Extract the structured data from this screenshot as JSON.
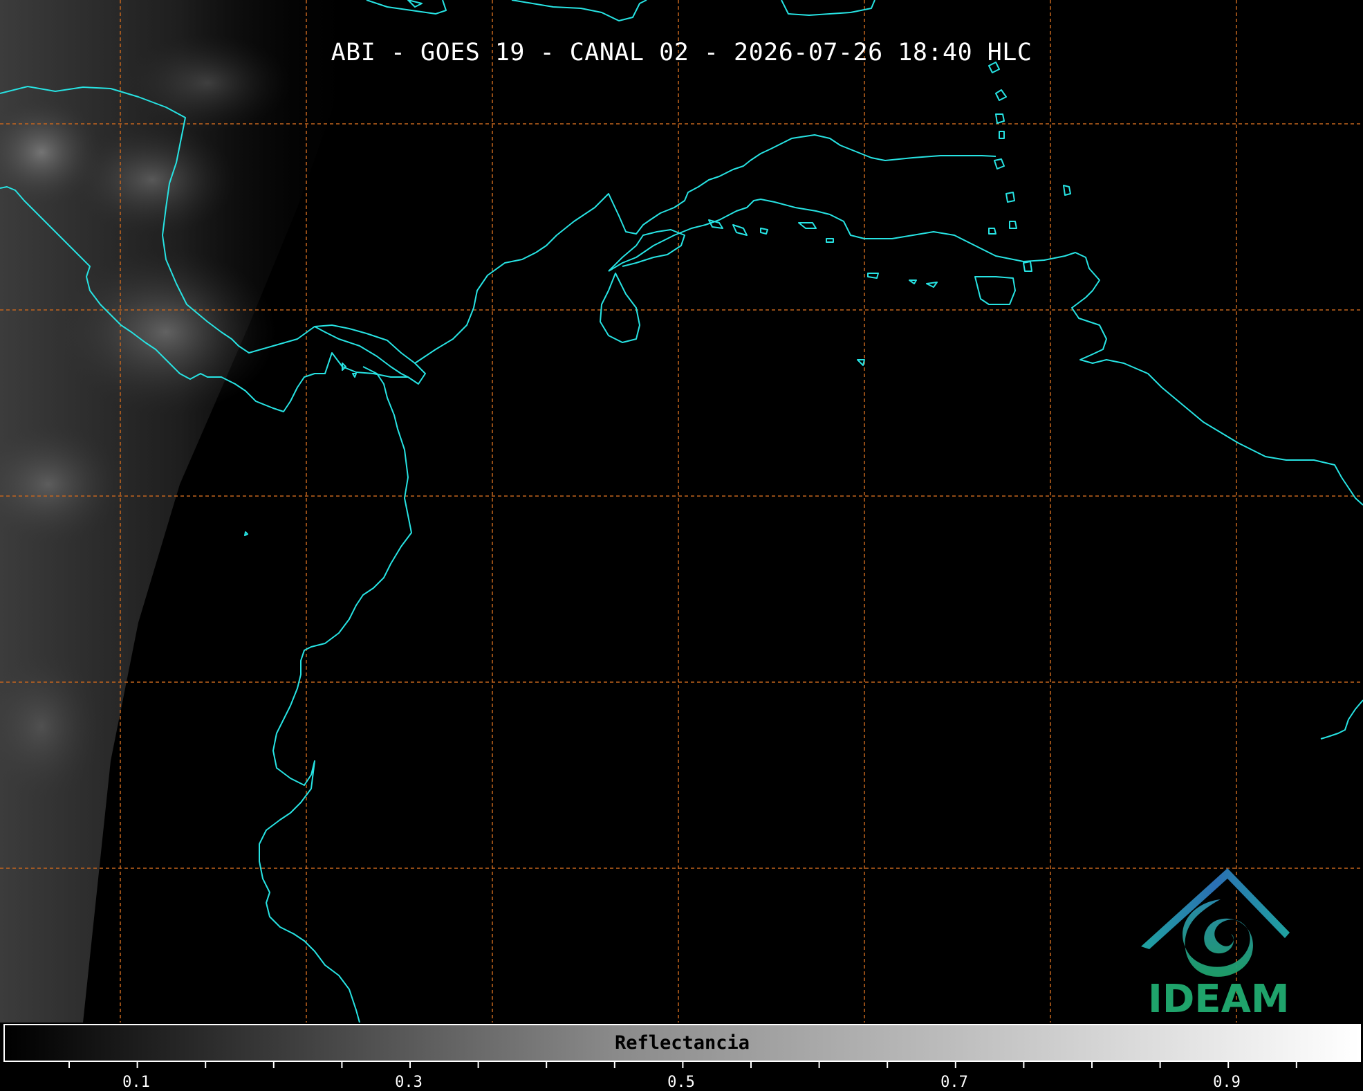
{
  "map": {
    "title": "ABI - GOES 19 - CANAL 02 - 2026-07-26 18:40 HLC",
    "coastline_color": "#27e3e3",
    "grid_color": "#c4651e",
    "grid_style": "dashed"
  },
  "colorbar": {
    "label": "Reflectancia",
    "ticks": [
      "0.1",
      "0.3",
      "0.5",
      "0.7",
      "0.9"
    ],
    "gradient": [
      "#000000",
      "#ffffff"
    ]
  },
  "logo": {
    "text": "IDEAM",
    "colors": [
      "#2b6fb4",
      "#1fa3a0",
      "#1fa36b"
    ]
  }
}
